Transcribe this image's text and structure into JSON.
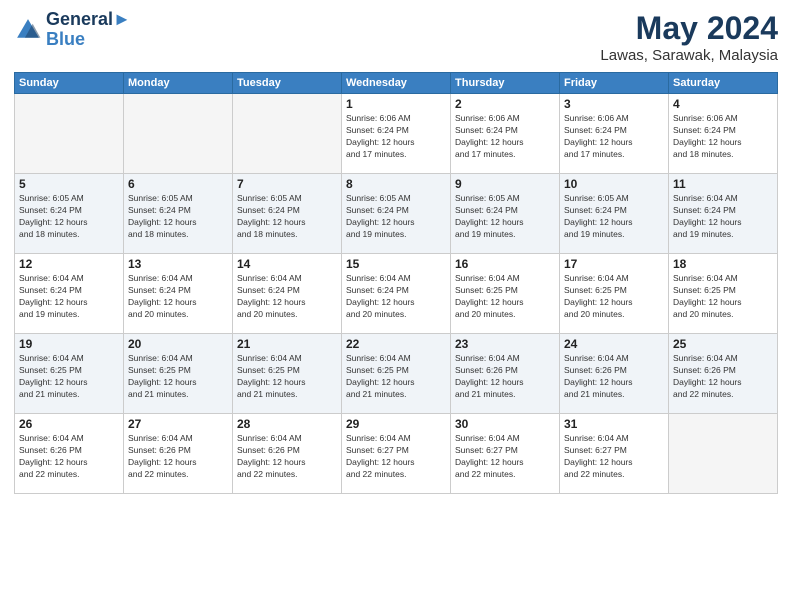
{
  "logo": {
    "line1": "General",
    "line2": "Blue"
  },
  "title": "May 2024",
  "subtitle": "Lawas, Sarawak, Malaysia",
  "weekdays": [
    "Sunday",
    "Monday",
    "Tuesday",
    "Wednesday",
    "Thursday",
    "Friday",
    "Saturday"
  ],
  "weeks": [
    [
      {
        "day": "",
        "info": ""
      },
      {
        "day": "",
        "info": ""
      },
      {
        "day": "",
        "info": ""
      },
      {
        "day": "1",
        "info": "Sunrise: 6:06 AM\nSunset: 6:24 PM\nDaylight: 12 hours\nand 17 minutes."
      },
      {
        "day": "2",
        "info": "Sunrise: 6:06 AM\nSunset: 6:24 PM\nDaylight: 12 hours\nand 17 minutes."
      },
      {
        "day": "3",
        "info": "Sunrise: 6:06 AM\nSunset: 6:24 PM\nDaylight: 12 hours\nand 17 minutes."
      },
      {
        "day": "4",
        "info": "Sunrise: 6:06 AM\nSunset: 6:24 PM\nDaylight: 12 hours\nand 18 minutes."
      }
    ],
    [
      {
        "day": "5",
        "info": "Sunrise: 6:05 AM\nSunset: 6:24 PM\nDaylight: 12 hours\nand 18 minutes."
      },
      {
        "day": "6",
        "info": "Sunrise: 6:05 AM\nSunset: 6:24 PM\nDaylight: 12 hours\nand 18 minutes."
      },
      {
        "day": "7",
        "info": "Sunrise: 6:05 AM\nSunset: 6:24 PM\nDaylight: 12 hours\nand 18 minutes."
      },
      {
        "day": "8",
        "info": "Sunrise: 6:05 AM\nSunset: 6:24 PM\nDaylight: 12 hours\nand 19 minutes."
      },
      {
        "day": "9",
        "info": "Sunrise: 6:05 AM\nSunset: 6:24 PM\nDaylight: 12 hours\nand 19 minutes."
      },
      {
        "day": "10",
        "info": "Sunrise: 6:05 AM\nSunset: 6:24 PM\nDaylight: 12 hours\nand 19 minutes."
      },
      {
        "day": "11",
        "info": "Sunrise: 6:04 AM\nSunset: 6:24 PM\nDaylight: 12 hours\nand 19 minutes."
      }
    ],
    [
      {
        "day": "12",
        "info": "Sunrise: 6:04 AM\nSunset: 6:24 PM\nDaylight: 12 hours\nand 19 minutes."
      },
      {
        "day": "13",
        "info": "Sunrise: 6:04 AM\nSunset: 6:24 PM\nDaylight: 12 hours\nand 20 minutes."
      },
      {
        "day": "14",
        "info": "Sunrise: 6:04 AM\nSunset: 6:24 PM\nDaylight: 12 hours\nand 20 minutes."
      },
      {
        "day": "15",
        "info": "Sunrise: 6:04 AM\nSunset: 6:24 PM\nDaylight: 12 hours\nand 20 minutes."
      },
      {
        "day": "16",
        "info": "Sunrise: 6:04 AM\nSunset: 6:25 PM\nDaylight: 12 hours\nand 20 minutes."
      },
      {
        "day": "17",
        "info": "Sunrise: 6:04 AM\nSunset: 6:25 PM\nDaylight: 12 hours\nand 20 minutes."
      },
      {
        "day": "18",
        "info": "Sunrise: 6:04 AM\nSunset: 6:25 PM\nDaylight: 12 hours\nand 20 minutes."
      }
    ],
    [
      {
        "day": "19",
        "info": "Sunrise: 6:04 AM\nSunset: 6:25 PM\nDaylight: 12 hours\nand 21 minutes."
      },
      {
        "day": "20",
        "info": "Sunrise: 6:04 AM\nSunset: 6:25 PM\nDaylight: 12 hours\nand 21 minutes."
      },
      {
        "day": "21",
        "info": "Sunrise: 6:04 AM\nSunset: 6:25 PM\nDaylight: 12 hours\nand 21 minutes."
      },
      {
        "day": "22",
        "info": "Sunrise: 6:04 AM\nSunset: 6:25 PM\nDaylight: 12 hours\nand 21 minutes."
      },
      {
        "day": "23",
        "info": "Sunrise: 6:04 AM\nSunset: 6:26 PM\nDaylight: 12 hours\nand 21 minutes."
      },
      {
        "day": "24",
        "info": "Sunrise: 6:04 AM\nSunset: 6:26 PM\nDaylight: 12 hours\nand 21 minutes."
      },
      {
        "day": "25",
        "info": "Sunrise: 6:04 AM\nSunset: 6:26 PM\nDaylight: 12 hours\nand 22 minutes."
      }
    ],
    [
      {
        "day": "26",
        "info": "Sunrise: 6:04 AM\nSunset: 6:26 PM\nDaylight: 12 hours\nand 22 minutes."
      },
      {
        "day": "27",
        "info": "Sunrise: 6:04 AM\nSunset: 6:26 PM\nDaylight: 12 hours\nand 22 minutes."
      },
      {
        "day": "28",
        "info": "Sunrise: 6:04 AM\nSunset: 6:26 PM\nDaylight: 12 hours\nand 22 minutes."
      },
      {
        "day": "29",
        "info": "Sunrise: 6:04 AM\nSunset: 6:27 PM\nDaylight: 12 hours\nand 22 minutes."
      },
      {
        "day": "30",
        "info": "Sunrise: 6:04 AM\nSunset: 6:27 PM\nDaylight: 12 hours\nand 22 minutes."
      },
      {
        "day": "31",
        "info": "Sunrise: 6:04 AM\nSunset: 6:27 PM\nDaylight: 12 hours\nand 22 minutes."
      },
      {
        "day": "",
        "info": ""
      }
    ]
  ],
  "colors": {
    "header_bg": "#3a7fc1",
    "logo_dark": "#1a3a5c",
    "logo_blue": "#3a7fc1"
  }
}
